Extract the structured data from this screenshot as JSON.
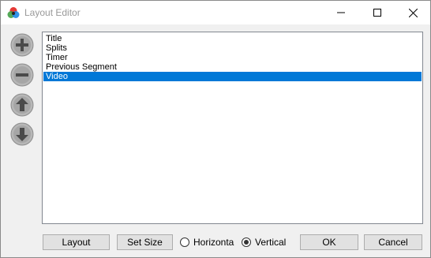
{
  "window": {
    "title": "Layout Editor",
    "icon": "livesplit-logo-icon"
  },
  "caption_buttons": {
    "minimize_icon": "minimize-icon",
    "maximize_icon": "maximize-icon",
    "close_icon": "close-icon"
  },
  "side_buttons": [
    {
      "name": "add-component-button",
      "icon": "plus-icon"
    },
    {
      "name": "remove-component-button",
      "icon": "minus-icon"
    },
    {
      "name": "move-up-button",
      "icon": "arrow-up-icon"
    },
    {
      "name": "move-down-button",
      "icon": "arrow-down-icon"
    }
  ],
  "components": {
    "items": [
      "Title",
      "Splits",
      "Timer",
      "Previous Segment",
      "Video"
    ],
    "selected": "Video"
  },
  "bottom": {
    "layout_label": "Layout",
    "set_size_label": "Set Size",
    "horizontal_label": "Horizonta",
    "vertical_label": "Vertical",
    "orientation_selected": "Vertical",
    "ok_label": "OK",
    "cancel_label": "Cancel"
  },
  "colors": {
    "selection": "#0078d7",
    "button_face": "#e1e1e1",
    "window_bg": "#f0f0f0",
    "side_button": "#ababab"
  }
}
